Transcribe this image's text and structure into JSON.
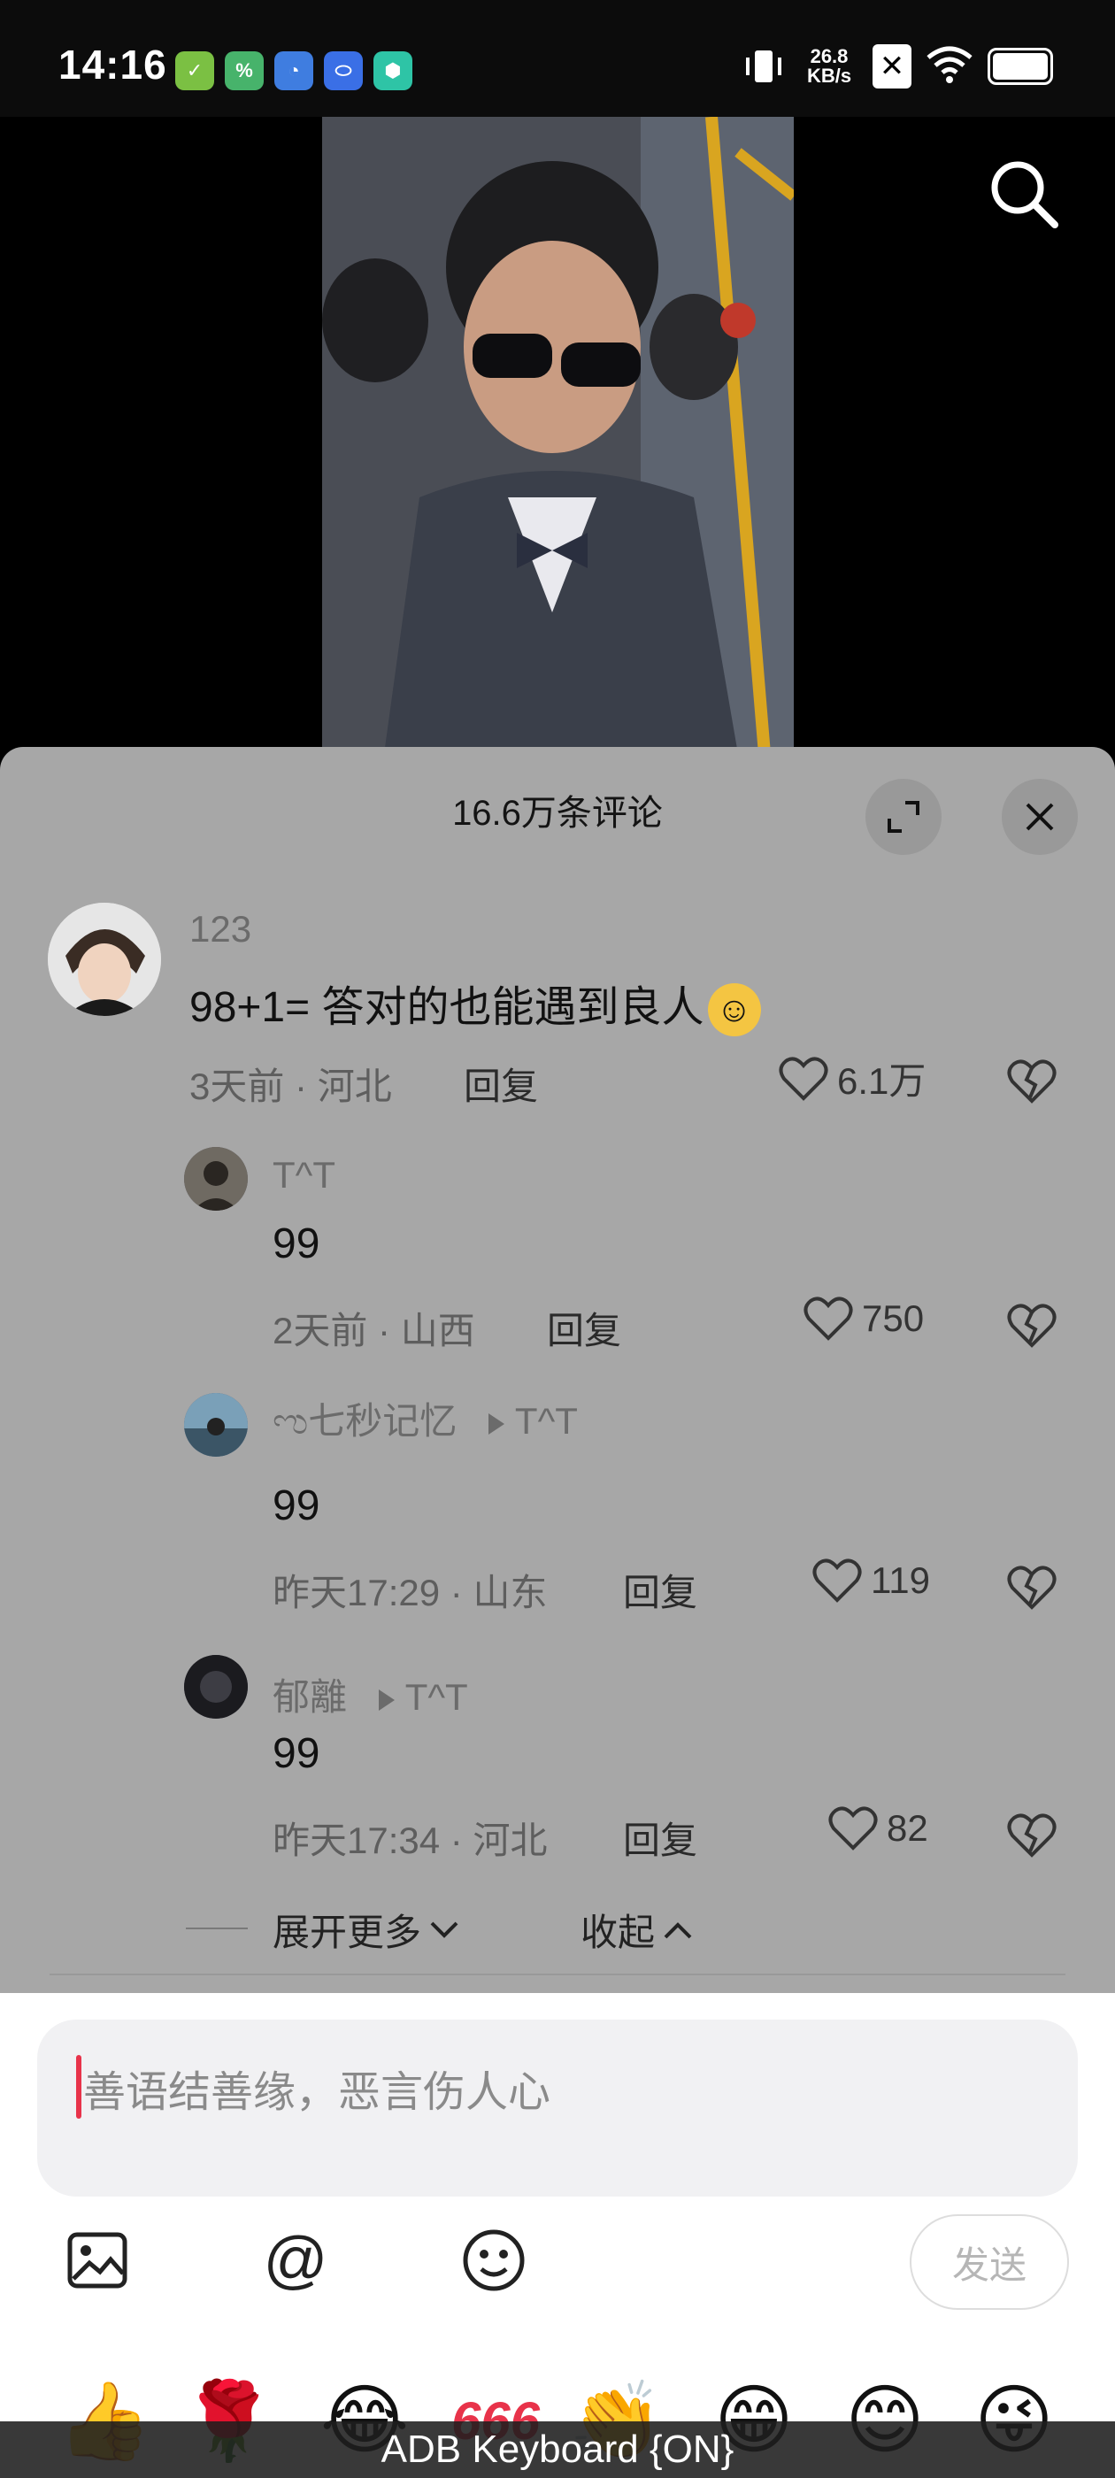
{
  "status_bar": {
    "time": "14:16",
    "net_speed_value": "26.8",
    "net_speed_unit": "KB/s",
    "app_icons": [
      "app-green-check-icon",
      "app-calc-icon",
      "app-blue-clock-icon",
      "app-blue-pill-icon",
      "app-teal-shield-icon"
    ]
  },
  "video": {
    "search_icon": "search-icon"
  },
  "comments_panel": {
    "title": "16.6万条评论",
    "expand_icon": "expand-icon",
    "close_icon": "close-icon",
    "comment": {
      "username": "123",
      "text": "98+1= 答对的也能遇到良人",
      "time": "3天前",
      "location": "河北",
      "reply_label": "回复",
      "likes": "6.1万"
    },
    "replies": [
      {
        "username": "T^T",
        "text": "99",
        "time": "2天前",
        "location": "山西",
        "reply_label": "回复",
        "likes": "750"
      },
      {
        "username": "ಌ七秒记忆",
        "reply_to": "T^T",
        "text": "99",
        "time": "昨天17:29",
        "location": "山东",
        "reply_label": "回复",
        "likes": "119"
      },
      {
        "username": "郁離",
        "reply_to": "T^T",
        "text": "99",
        "time": "昨天17:34",
        "location": "河北",
        "reply_label": "回复",
        "likes": "82"
      }
    ],
    "expand_more": "展开更多",
    "collapse": "收起"
  },
  "input": {
    "placeholder": "善语结善缘，恶言伤人心",
    "send_label": "发送",
    "tools": [
      "image-icon",
      "at-icon",
      "emoji-face-icon"
    ]
  },
  "emoji_bar": {
    "emojis": [
      "👍",
      "🌹",
      "😂",
      "666",
      "👏",
      "😁",
      "😊",
      "😜"
    ],
    "keyboard_status": "ADB Keyboard {ON}"
  },
  "colors": {
    "panel_bg": "#a7a7a7",
    "caret": "#e8334a",
    "input_bg": "#f1f1f3"
  }
}
